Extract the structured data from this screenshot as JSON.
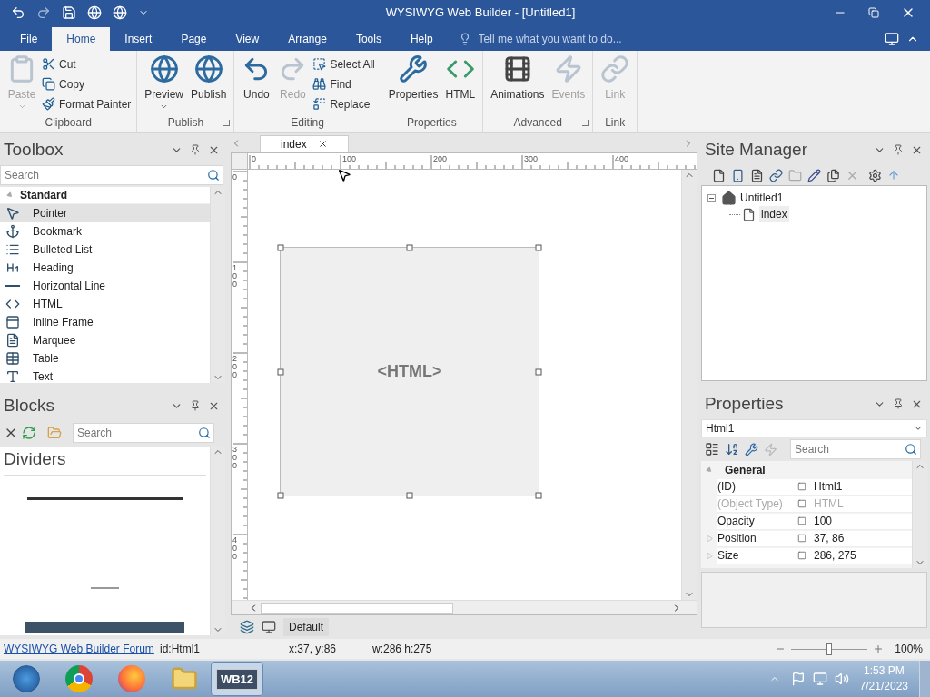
{
  "window": {
    "title": "WYSIWYG Web Builder - [Untitled1]"
  },
  "menu_tabs": [
    {
      "label": "File",
      "selected": false
    },
    {
      "label": "Home",
      "selected": true
    },
    {
      "label": "Insert",
      "selected": false
    },
    {
      "label": "Page",
      "selected": false
    },
    {
      "label": "View",
      "selected": false
    },
    {
      "label": "Arrange",
      "selected": false
    },
    {
      "label": "Tools",
      "selected": false
    },
    {
      "label": "Help",
      "selected": false
    }
  ],
  "tell_me": {
    "placeholder": "Tell me what you want to do..."
  },
  "ribbon": {
    "groups": [
      {
        "label": "Clipboard",
        "launcher": false,
        "items": [
          {
            "label": "Paste",
            "kind": "large",
            "disabled": true,
            "dropdown": true
          },
          {
            "label": "Cut",
            "kind": "small",
            "disabled": false
          },
          {
            "label": "Copy",
            "kind": "small",
            "disabled": false
          },
          {
            "label": "Format Painter",
            "kind": "small",
            "disabled": false
          }
        ]
      },
      {
        "label": "Publish",
        "launcher": true,
        "items": [
          {
            "label": "Preview",
            "kind": "large",
            "disabled": false,
            "dropdown": true
          },
          {
            "label": "Publish",
            "kind": "large",
            "disabled": false,
            "dropdown": false
          }
        ]
      },
      {
        "label": "Editing",
        "launcher": false,
        "items": [
          {
            "label": "Undo",
            "kind": "large",
            "disabled": false,
            "dropdown": false
          },
          {
            "label": "Redo",
            "kind": "large",
            "disabled": true,
            "dropdown": false
          },
          {
            "label": "Select All",
            "kind": "small",
            "disabled": false
          },
          {
            "label": "Find",
            "kind": "small",
            "disabled": false
          },
          {
            "label": "Replace",
            "kind": "small",
            "disabled": false
          }
        ]
      },
      {
        "label": "Properties",
        "launcher": false,
        "items": [
          {
            "label": "Properties",
            "kind": "large",
            "disabled": false,
            "dropdown": false
          },
          {
            "label": "HTML",
            "kind": "large",
            "disabled": false,
            "dropdown": false
          }
        ]
      },
      {
        "label": "Advanced",
        "launcher": true,
        "items": [
          {
            "label": "Animations",
            "kind": "large",
            "disabled": false,
            "dropdown": false
          },
          {
            "label": "Events",
            "kind": "large",
            "disabled": true,
            "dropdown": false
          }
        ]
      },
      {
        "label": "Link",
        "launcher": false,
        "items": [
          {
            "label": "Link",
            "kind": "large",
            "disabled": true,
            "dropdown": false
          }
        ]
      }
    ]
  },
  "toolbox": {
    "title": "Toolbox",
    "search": {
      "placeholder": "Search"
    },
    "category": {
      "label": "Standard",
      "expanded": true
    },
    "items": [
      {
        "label": "Pointer",
        "selected": true
      },
      {
        "label": "Bookmark",
        "selected": false
      },
      {
        "label": "Bulleted List",
        "selected": false
      },
      {
        "label": "Heading",
        "selected": false
      },
      {
        "label": "Horizontal Line",
        "selected": false
      },
      {
        "label": "HTML",
        "selected": false
      },
      {
        "label": "Inline Frame",
        "selected": false
      },
      {
        "label": "Marquee",
        "selected": false
      },
      {
        "label": "Table",
        "selected": false
      },
      {
        "label": "Text",
        "selected": false
      }
    ]
  },
  "blocks": {
    "title": "Blocks",
    "search": {
      "placeholder": "Search"
    },
    "heading": "Dividers"
  },
  "document": {
    "tabs": [
      {
        "label": "index",
        "selected": true
      }
    ],
    "ruler": {
      "horizontal": [
        "0",
        "100",
        "200",
        "300",
        "400"
      ],
      "vertical": [
        "0",
        "100",
        "200",
        "300",
        "400"
      ]
    },
    "element": {
      "label": "<HTML>",
      "selected": true
    },
    "layout": "Default"
  },
  "site_manager": {
    "title": "Site Manager",
    "tree": [
      {
        "label": "Untitled1",
        "expanded": true,
        "children": [
          {
            "label": "index",
            "selected": true
          }
        ]
      }
    ]
  },
  "properties": {
    "title": "Properties",
    "object": "Html1",
    "search": {
      "placeholder": "Search"
    },
    "section": {
      "label": "General",
      "expanded": true
    },
    "rows": [
      {
        "name": "(ID)",
        "value": "Html1",
        "disabled": false,
        "expandable": false
      },
      {
        "name": "(Object Type)",
        "value": "HTML",
        "disabled": true,
        "expandable": false
      },
      {
        "name": "Opacity",
        "value": "100",
        "disabled": false,
        "expandable": false
      },
      {
        "name": "Position",
        "value": "37, 86",
        "disabled": false,
        "expandable": true
      },
      {
        "name": "Size",
        "value": "286, 275",
        "disabled": false,
        "expandable": true
      }
    ]
  },
  "status_bar": {
    "link": "WYSIWYG Web Builder Forum",
    "id": "id:Html1",
    "position": "x:37, y:86",
    "size": "w:286 h:275",
    "zoom": {
      "level": 0.5,
      "reading": "100%"
    }
  },
  "taskbar": {
    "apps": [
      {
        "kind": "chrome",
        "active": false
      },
      {
        "kind": "firefox",
        "active": false
      },
      {
        "kind": "folder",
        "active": false
      },
      {
        "kind": "builder",
        "label": "WB12",
        "active": true
      }
    ],
    "time": "1:53 PM",
    "date": "7/21/2023"
  }
}
